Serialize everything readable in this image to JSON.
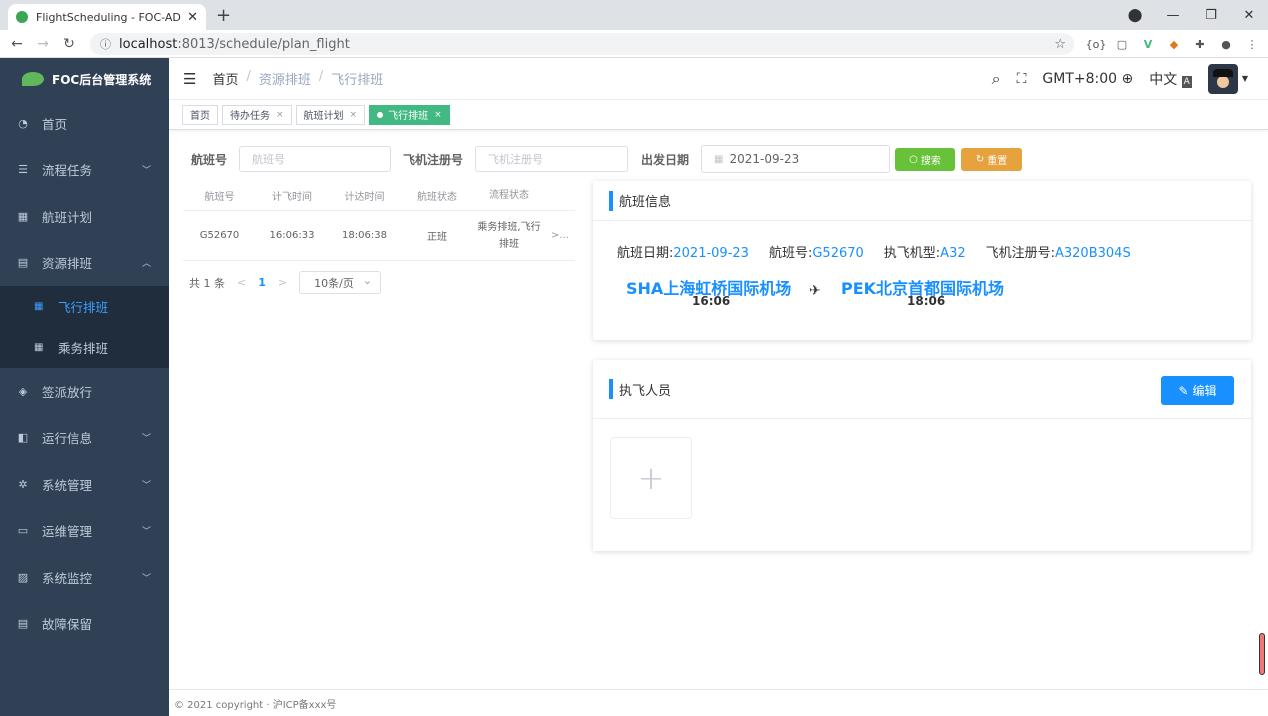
{
  "browser": {
    "tab_title": "FlightScheduling - FOC-ADMIN",
    "close_icon": "✕",
    "new_tab": "+",
    "url": "localhost:8013/schedule/plan_flight",
    "url_host": "localhost",
    "url_rest": ":8013/schedule/plan_flight"
  },
  "sidebar": {
    "logo_text": "FOC后台管理系统",
    "items": [
      {
        "label": "首页",
        "icon": "dashboard-icon",
        "glyph": "◔",
        "has_arrow": false
      },
      {
        "label": "流程任务",
        "icon": "list-icon",
        "glyph": "☰",
        "has_arrow": true
      },
      {
        "label": "航班计划",
        "icon": "calendar-icon",
        "glyph": "▦",
        "has_arrow": false
      },
      {
        "label": "资源排班",
        "icon": "schedule-icon",
        "glyph": "▤",
        "has_arrow": true,
        "open": true
      }
    ],
    "sub_items": [
      {
        "label": "飞行排班",
        "active": true
      },
      {
        "label": "乘务排班",
        "active": false
      }
    ],
    "items_after": [
      {
        "label": "签派放行",
        "icon": "shield-icon",
        "glyph": "◈"
      },
      {
        "label": "运行信息",
        "icon": "info-icon",
        "glyph": "◧"
      },
      {
        "label": "系统管理",
        "icon": "gear-icon",
        "glyph": "✲"
      },
      {
        "label": "运维管理",
        "icon": "monitor-icon",
        "glyph": "▭"
      },
      {
        "label": "系统监控",
        "icon": "chart-icon",
        "glyph": "▨"
      },
      {
        "label": "故障保留",
        "icon": "doc-icon",
        "glyph": "▤"
      }
    ]
  },
  "navbar": {
    "breadcrumb": [
      "首页",
      "资源排班",
      "飞行排班"
    ],
    "timezone": "GMT+8:00",
    "language": "中文"
  },
  "tags": [
    {
      "label": "首页",
      "closable": false,
      "active": false
    },
    {
      "label": "待办任务",
      "closable": true,
      "active": false
    },
    {
      "label": "航班计划",
      "closable": true,
      "active": false
    },
    {
      "label": "飞行排班",
      "closable": true,
      "active": true
    }
  ],
  "search": {
    "flight_label": "航班号",
    "flight_placeholder": "航班号",
    "reg_label": "飞机注册号",
    "reg_placeholder": "飞机注册号",
    "date_label": "出发日期",
    "date_value": "2021-09-23",
    "search_btn": "搜索",
    "reset_btn": "重置",
    "search_color": "#67c23a",
    "reset_color": "#e6a23c"
  },
  "table": {
    "headers": [
      "航班号",
      "计飞时间",
      "计达时间",
      "航班状态",
      "流程状态"
    ],
    "rows": [
      {
        "flight": "G52670",
        "dep": "16:06:33",
        "arr": "18:06:38",
        "status": "正班",
        "process": "乘务排班,飞行排班",
        "more": ">..."
      }
    ]
  },
  "pager": {
    "total": "共 1 条",
    "current": "1",
    "prev": "<",
    "next": ">",
    "page_size": "10条/页"
  },
  "flight_info": {
    "title": "航班信息",
    "date_label": "航班日期:",
    "date": "2021-09-23",
    "no_label": "航班号:",
    "no": "G52670",
    "type_label": "执飞机型:",
    "type": "A32",
    "reg_label": "飞机注册号:",
    "reg": "A320B304S",
    "dep_airport": "SHA上海虹桥国际机场",
    "dep_time": "16:06",
    "arr_airport": "PEK北京首都国际机场",
    "arr_time": "18:06",
    "plane_glyph": "✈"
  },
  "crew": {
    "title": "执飞人员",
    "edit_btn": "编辑",
    "add": "+"
  },
  "footer": {
    "text": "© 2021 copyright · 沪ICP备xxx号"
  },
  "colors": {
    "sidebar": "#304156",
    "accent": "#1890ff",
    "active_tag": "#42b983"
  }
}
